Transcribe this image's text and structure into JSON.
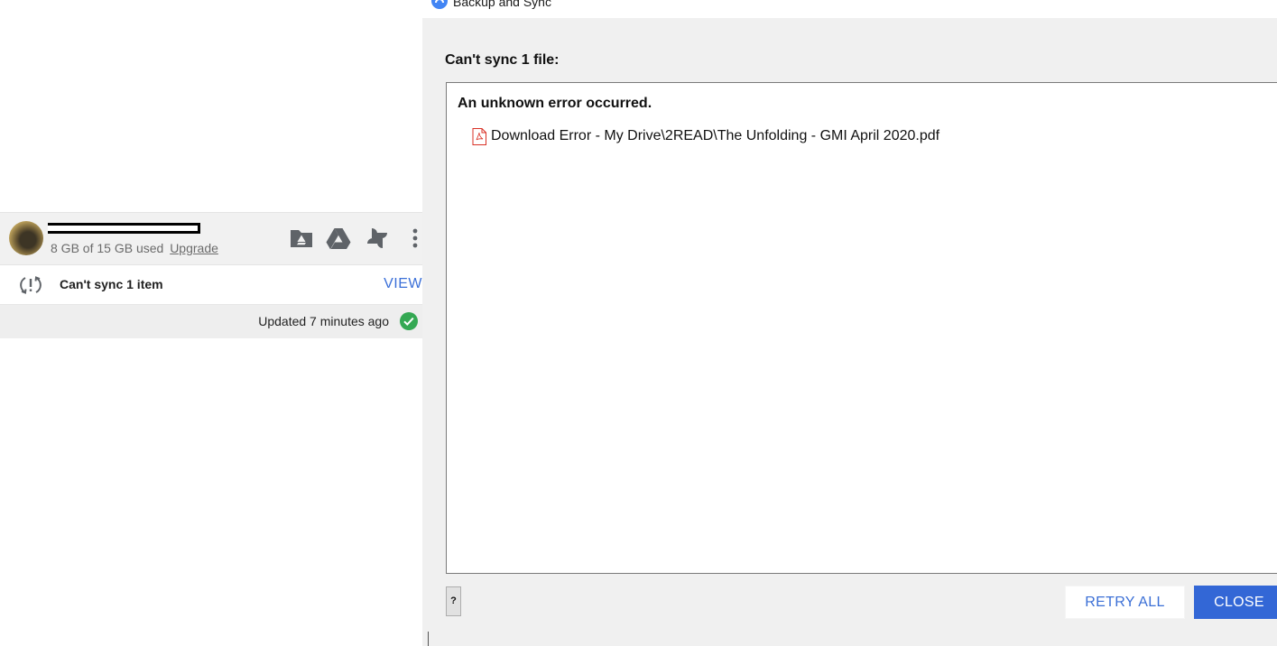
{
  "tray": {
    "account": {
      "quota_text": "8 GB of 15 GB used",
      "upgrade_label": "Upgrade"
    },
    "toolbar": {
      "icons": [
        "open-folder-icon",
        "google-drive-icon",
        "google-photos-icon",
        "more-vert-icon"
      ]
    },
    "alert": {
      "text": "Can't sync 1 item",
      "action_label": "VIEW"
    },
    "status": {
      "text": "Updated 7 minutes ago"
    }
  },
  "dialog": {
    "window_title": "Backup and Sync",
    "heading": "Can't sync 1 file:",
    "error_group_title": "An unknown error occurred.",
    "errors": [
      {
        "icon": "pdf-file-icon",
        "text": "Download Error - My Drive\\2READ\\The Unfolding - GMI April 2020.pdf"
      }
    ],
    "help_label": "?",
    "retry_label": "RETRY ALL",
    "close_label": "CLOSE"
  },
  "colors": {
    "accent_blue": "#3367d6",
    "link_blue": "#3a6fd8",
    "success_green": "#34a853",
    "pdf_red": "#d93025"
  }
}
